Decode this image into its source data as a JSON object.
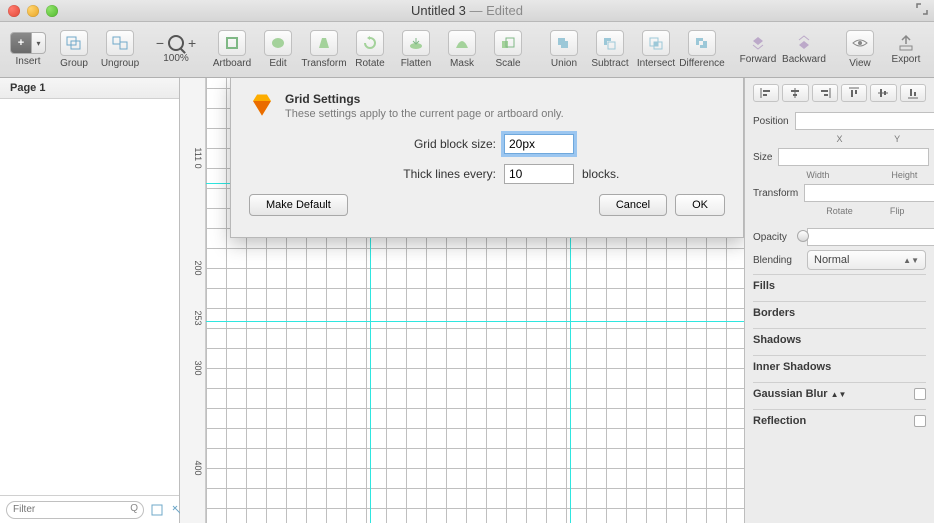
{
  "window": {
    "title": "Untitled 3",
    "edited": " — Edited"
  },
  "toolbar": {
    "insert": "Insert",
    "group": "Group",
    "ungroup": "Ungroup",
    "zoom": "100%",
    "artboard": "Artboard",
    "edit": "Edit",
    "transform": "Transform",
    "rotate": "Rotate",
    "flatten": "Flatten",
    "mask": "Mask",
    "scale": "Scale",
    "union": "Union",
    "subtract": "Subtract",
    "intersect": "Intersect",
    "difference": "Difference",
    "forward": "Forward",
    "backward": "Backward",
    "view": "View",
    "export": "Export"
  },
  "sidebar": {
    "page": "Page 1",
    "filter_placeholder": "Filter"
  },
  "ruler": {
    "t111": "111 0",
    "t200": "200",
    "t253": "253",
    "t300": "300",
    "t400": "400"
  },
  "dialog": {
    "title": "Grid Settings",
    "subtitle": "These settings apply to the current page or artboard only.",
    "grid_block_label": "Grid block size:",
    "grid_block_value": "20px",
    "thick_lines_label": "Thick lines every:",
    "thick_lines_value": "10",
    "thick_lines_suffix": "blocks.",
    "make_default": "Make Default",
    "cancel": "Cancel",
    "ok": "OK"
  },
  "inspector": {
    "position": "Position",
    "x": "X",
    "y": "Y",
    "size": "Size",
    "width": "Width",
    "height": "Height",
    "transform": "Transform",
    "rotate": "Rotate",
    "flip": "Flip",
    "opacity": "Opacity",
    "blending": "Blending",
    "blending_value": "Normal",
    "fills": "Fills",
    "borders": "Borders",
    "shadows": "Shadows",
    "inner_shadows": "Inner Shadows",
    "gaussian_blur": "Gaussian Blur",
    "reflection": "Reflection"
  }
}
